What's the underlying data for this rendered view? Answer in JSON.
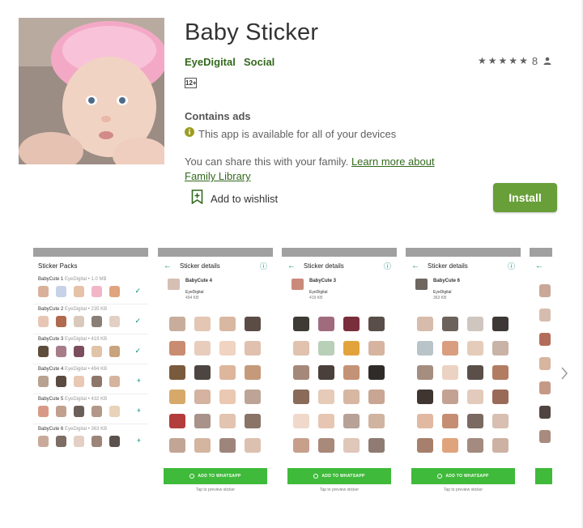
{
  "app": {
    "title": "Baby Sticker",
    "developer": "EyeDigital",
    "category": "Social",
    "rating_count": "8",
    "age_badge": "12+",
    "contains_ads": "Contains ads",
    "availability": "This app is available for all of your devices",
    "share_text": "You can share this with your family.",
    "share_link": "Learn more about Family Library",
    "wishlist_label": "Add to wishlist",
    "install_label": "Install"
  },
  "icons": {
    "star": "star-icon",
    "person": "person-icon",
    "info": "info-icon",
    "wishlist": "bookmark-add-icon",
    "next": "chevron-right-icon"
  },
  "colors": {
    "accent": "#689f38",
    "link": "#33691e",
    "whatsapp_button": "#3fba3a",
    "teal": "#00897b"
  },
  "screenshots": {
    "list": {
      "header": "Sticker Packs",
      "packs": [
        {
          "name": "BabyCute 1",
          "meta": "EyeDigital • 1.0 MB",
          "action": "✓"
        },
        {
          "name": "BabyCute 2",
          "meta": "EyeDigital • 235 KB",
          "action": "✓"
        },
        {
          "name": "BabyCute 3",
          "meta": "EyeDigital • 419 KB",
          "action": "✓"
        },
        {
          "name": "BabyCute 4",
          "meta": "EyeDigital • 494 KB",
          "action": "+"
        },
        {
          "name": "BabyCute 5",
          "meta": "EyeDigital • 432 KB",
          "action": "+"
        },
        {
          "name": "BabyCute 6",
          "meta": "EyeDigital • 363 KB",
          "action": "+"
        }
      ]
    },
    "details": [
      {
        "header": "Sticker details",
        "pack": "BabyCute 4",
        "developer": "EyeDigital",
        "size": "494 KB",
        "button": "ADD TO WHATSAPP",
        "hint": "Tap to preview sticker"
      },
      {
        "header": "Sticker details",
        "pack": "BabyCute 3",
        "developer": "EyeDigital",
        "size": "419 KB",
        "button": "ADD TO WHATSAPP",
        "hint": "Tap to preview sticker"
      },
      {
        "header": "Sticker details",
        "pack": "BabyCute 6",
        "developer": "EyeDigital",
        "size": "363 KB",
        "button": "ADD TO WHATSAPP",
        "hint": "Tap to preview sticker"
      }
    ]
  }
}
